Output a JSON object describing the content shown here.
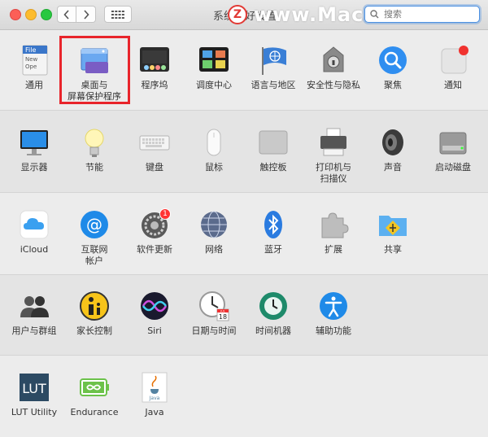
{
  "window": {
    "title": "系统偏好设置",
    "watermark_logo": "Z",
    "watermark_text": "www.MacZ.com",
    "search_placeholder": "搜索"
  },
  "sections": [
    {
      "items": [
        {
          "id": "general",
          "label": "通用",
          "icon": "general-icon"
        },
        {
          "id": "desktop",
          "label": "桌面与\n屏幕保护程序",
          "icon": "desktop-screensaver-icon",
          "highlighted": true
        },
        {
          "id": "dock",
          "label": "程序坞",
          "icon": "dock-icon"
        },
        {
          "id": "mission",
          "label": "调度中心",
          "icon": "mission-control-icon"
        },
        {
          "id": "language",
          "label": "语言与地区",
          "icon": "language-region-icon"
        },
        {
          "id": "security",
          "label": "安全性与隐私",
          "icon": "security-privacy-icon"
        },
        {
          "id": "spotlight",
          "label": "聚焦",
          "icon": "spotlight-icon"
        },
        {
          "id": "notifications",
          "label": "通知",
          "icon": "notifications-icon"
        }
      ]
    },
    {
      "items": [
        {
          "id": "displays",
          "label": "显示器",
          "icon": "displays-icon"
        },
        {
          "id": "energy",
          "label": "节能",
          "icon": "energy-saver-icon"
        },
        {
          "id": "keyboard",
          "label": "键盘",
          "icon": "keyboard-icon"
        },
        {
          "id": "mouse",
          "label": "鼠标",
          "icon": "mouse-icon"
        },
        {
          "id": "trackpad",
          "label": "触控板",
          "icon": "trackpad-icon"
        },
        {
          "id": "printers",
          "label": "打印机与\n扫描仪",
          "icon": "printer-icon"
        },
        {
          "id": "sound",
          "label": "声音",
          "icon": "sound-icon"
        },
        {
          "id": "startup",
          "label": "启动磁盘",
          "icon": "startup-disk-icon"
        }
      ]
    },
    {
      "items": [
        {
          "id": "icloud",
          "label": "iCloud",
          "icon": "icloud-icon"
        },
        {
          "id": "internet",
          "label": "互联网\n帐户",
          "icon": "internet-accounts-icon"
        },
        {
          "id": "update",
          "label": "软件更新",
          "icon": "software-update-icon",
          "badge": "1"
        },
        {
          "id": "network",
          "label": "网络",
          "icon": "network-icon"
        },
        {
          "id": "bluetooth",
          "label": "蓝牙",
          "icon": "bluetooth-icon"
        },
        {
          "id": "extensions",
          "label": "扩展",
          "icon": "extensions-icon"
        },
        {
          "id": "sharing",
          "label": "共享",
          "icon": "sharing-icon"
        }
      ]
    },
    {
      "items": [
        {
          "id": "users",
          "label": "用户与群组",
          "icon": "users-groups-icon"
        },
        {
          "id": "parental",
          "label": "家长控制",
          "icon": "parental-controls-icon"
        },
        {
          "id": "siri",
          "label": "Siri",
          "icon": "siri-icon"
        },
        {
          "id": "datetime",
          "label": "日期与时间",
          "icon": "date-time-icon",
          "calendar_day": "18",
          "calendar_month": "JUL"
        },
        {
          "id": "timemachine",
          "label": "时间机器",
          "icon": "time-machine-icon"
        },
        {
          "id": "accessibility",
          "label": "辅助功能",
          "icon": "accessibility-icon"
        }
      ]
    },
    {
      "items": [
        {
          "id": "lut",
          "label": "LUT Utility",
          "icon": "lut-utility-icon",
          "icon_text": "LUT"
        },
        {
          "id": "endurance",
          "label": "Endurance",
          "icon": "endurance-icon"
        },
        {
          "id": "java",
          "label": "Java",
          "icon": "java-icon",
          "icon_text": "Java"
        }
      ]
    }
  ],
  "general_icon_text": [
    "File",
    "New",
    "Ope"
  ]
}
